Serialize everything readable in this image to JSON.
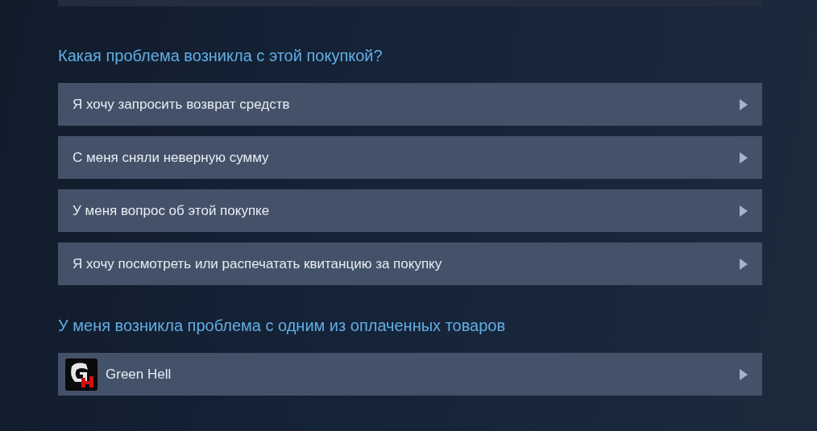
{
  "sections": [
    {
      "title": "Какая проблема возникла с этой покупкой?",
      "items": [
        {
          "kind": "option",
          "label": "Я хочу запросить возврат средств"
        },
        {
          "kind": "option",
          "label": "С меня сняли неверную сумму"
        },
        {
          "kind": "option",
          "label": "У меня вопрос об этой покупке"
        },
        {
          "kind": "option",
          "label": "Я хочу посмотреть или распечатать квитанцию за покупку"
        }
      ]
    },
    {
      "title": "У меня возникла проблема с одним из оплаченных товаров",
      "items": [
        {
          "kind": "game",
          "label": "Green Hell"
        }
      ]
    }
  ]
}
